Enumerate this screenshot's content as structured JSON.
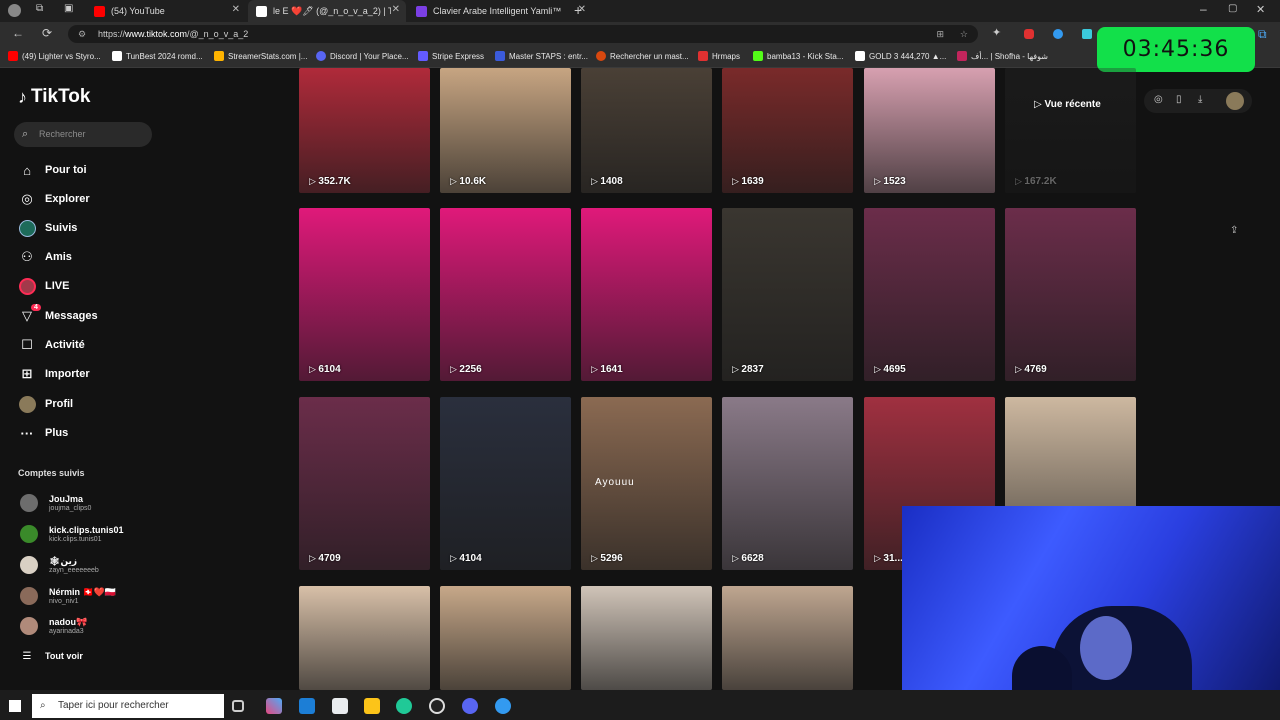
{
  "browser": {
    "tabs": [
      {
        "title": "(54) YouTube",
        "favicon_color": "#ff0000"
      },
      {
        "title": "le E ❤️🖊 (@_n_o_v_a_2) | TikTok",
        "favicon_color": "#ffffff"
      },
      {
        "title": "Clavier Arabe Intelligent Yamli™",
        "favicon_color": "#7b3fe4"
      }
    ],
    "new_tab_icon": "plus-icon",
    "url_prefix": "https://",
    "url_domain": "www.tiktok.com",
    "url_path": "/@_n_o_v_a_2",
    "bookmarks": [
      {
        "label": "(49) Lighter vs Styro...",
        "color": "#ff0000"
      },
      {
        "label": "TunBest 2024 romd...",
        "color": "#ffffff"
      },
      {
        "label": "StreamerStats.com |...",
        "color": "#ffb400"
      },
      {
        "label": "Discord | Your Place...",
        "color": "#5865f2"
      },
      {
        "label": "Stripe Express",
        "color": "#635bff"
      },
      {
        "label": "Master STAPS : entr...",
        "color": "#3b5bdb"
      },
      {
        "label": "Rechercher un mast...",
        "color": "#d9480f"
      },
      {
        "label": "Hrmaps",
        "color": "#e03131"
      },
      {
        "label": "bamba13 - Kick Sta...",
        "color": "#53fc18"
      },
      {
        "label": "GOLD 3 444,270 ▲...",
        "color": "#ffffff"
      },
      {
        "label": "أف... | Shofha - شوفها",
        "color": "#c2255c"
      }
    ]
  },
  "timer": "03:45:36",
  "sidebar": {
    "logo": "TikTok",
    "search_placeholder": "Rechercher",
    "nav": [
      {
        "label": "Pour toi",
        "icon": "home-icon"
      },
      {
        "label": "Explorer",
        "icon": "compass-icon"
      },
      {
        "label": "Suivis",
        "icon": "following-icon"
      },
      {
        "label": "Amis",
        "icon": "friends-icon"
      },
      {
        "label": "LIVE",
        "icon": "live-icon"
      },
      {
        "label": "Messages",
        "icon": "messages-icon",
        "badge": "4"
      },
      {
        "label": "Activité",
        "icon": "activity-icon"
      },
      {
        "label": "Importer",
        "icon": "upload-icon"
      },
      {
        "label": "Profil",
        "icon": "profile-icon"
      },
      {
        "label": "Plus",
        "icon": "more-icon"
      }
    ],
    "followed_title": "Comptes suivis",
    "followed": [
      {
        "name": "JouJma",
        "handle": "joujma_clips0"
      },
      {
        "name": "kick.clips.tunis01",
        "handle": "kick.clips.tunis01"
      },
      {
        "name": "🕸زين",
        "handle": "zayn_eeeeeeeb"
      },
      {
        "name": "Nérmin 🇨🇭❤️🇵🇱",
        "handle": "nivo_niv1"
      },
      {
        "name": "nadou🎀",
        "handle": "ayarinada3"
      }
    ],
    "see_all": "Tout voir"
  },
  "profile": {
    "recent_label": "Vue récente",
    "videos": [
      {
        "views": "352.7K",
        "bg": "#b02a3a"
      },
      {
        "views": "10.6K",
        "bg": "#c7a582"
      },
      {
        "views": "1408",
        "bg": "#4a4036"
      },
      {
        "views": "1639",
        "bg": "#7a2a2a"
      },
      {
        "views": "1523",
        "bg": "#d7a0b0"
      },
      {
        "views": "167.2K",
        "bg": "#2a2a2a"
      },
      {
        "views": "6104",
        "bg": "#e0197a"
      },
      {
        "views": "2256",
        "bg": "#e0197a"
      },
      {
        "views": "1641",
        "bg": "#e0197a"
      },
      {
        "views": "2837",
        "bg": "#3a3630"
      },
      {
        "views": "4695",
        "bg": "#6b2d4a"
      },
      {
        "views": "4769",
        "bg": "#6b2d4a"
      },
      {
        "views": "4709",
        "bg": "#6b2d4a"
      },
      {
        "views": "4104",
        "bg": "#2a2f3d"
      },
      {
        "views": "5296",
        "bg": "#8b6a52",
        "overlay": "Ayouuu"
      },
      {
        "views": "6628",
        "bg": "#8a7a88"
      },
      {
        "views": "31...",
        "bg": "#a03040"
      },
      {
        "views": "",
        "bg": "#cdb8a0"
      },
      {
        "views": "",
        "bg": "#d8c0a8"
      },
      {
        "views": "",
        "bg": "#c7a889"
      },
      {
        "views": "",
        "bg": "#d0c4b8"
      },
      {
        "views": "",
        "bg": "#bfa690"
      }
    ]
  },
  "taskbar": {
    "search_placeholder": "Taper ici pour rechercher"
  }
}
